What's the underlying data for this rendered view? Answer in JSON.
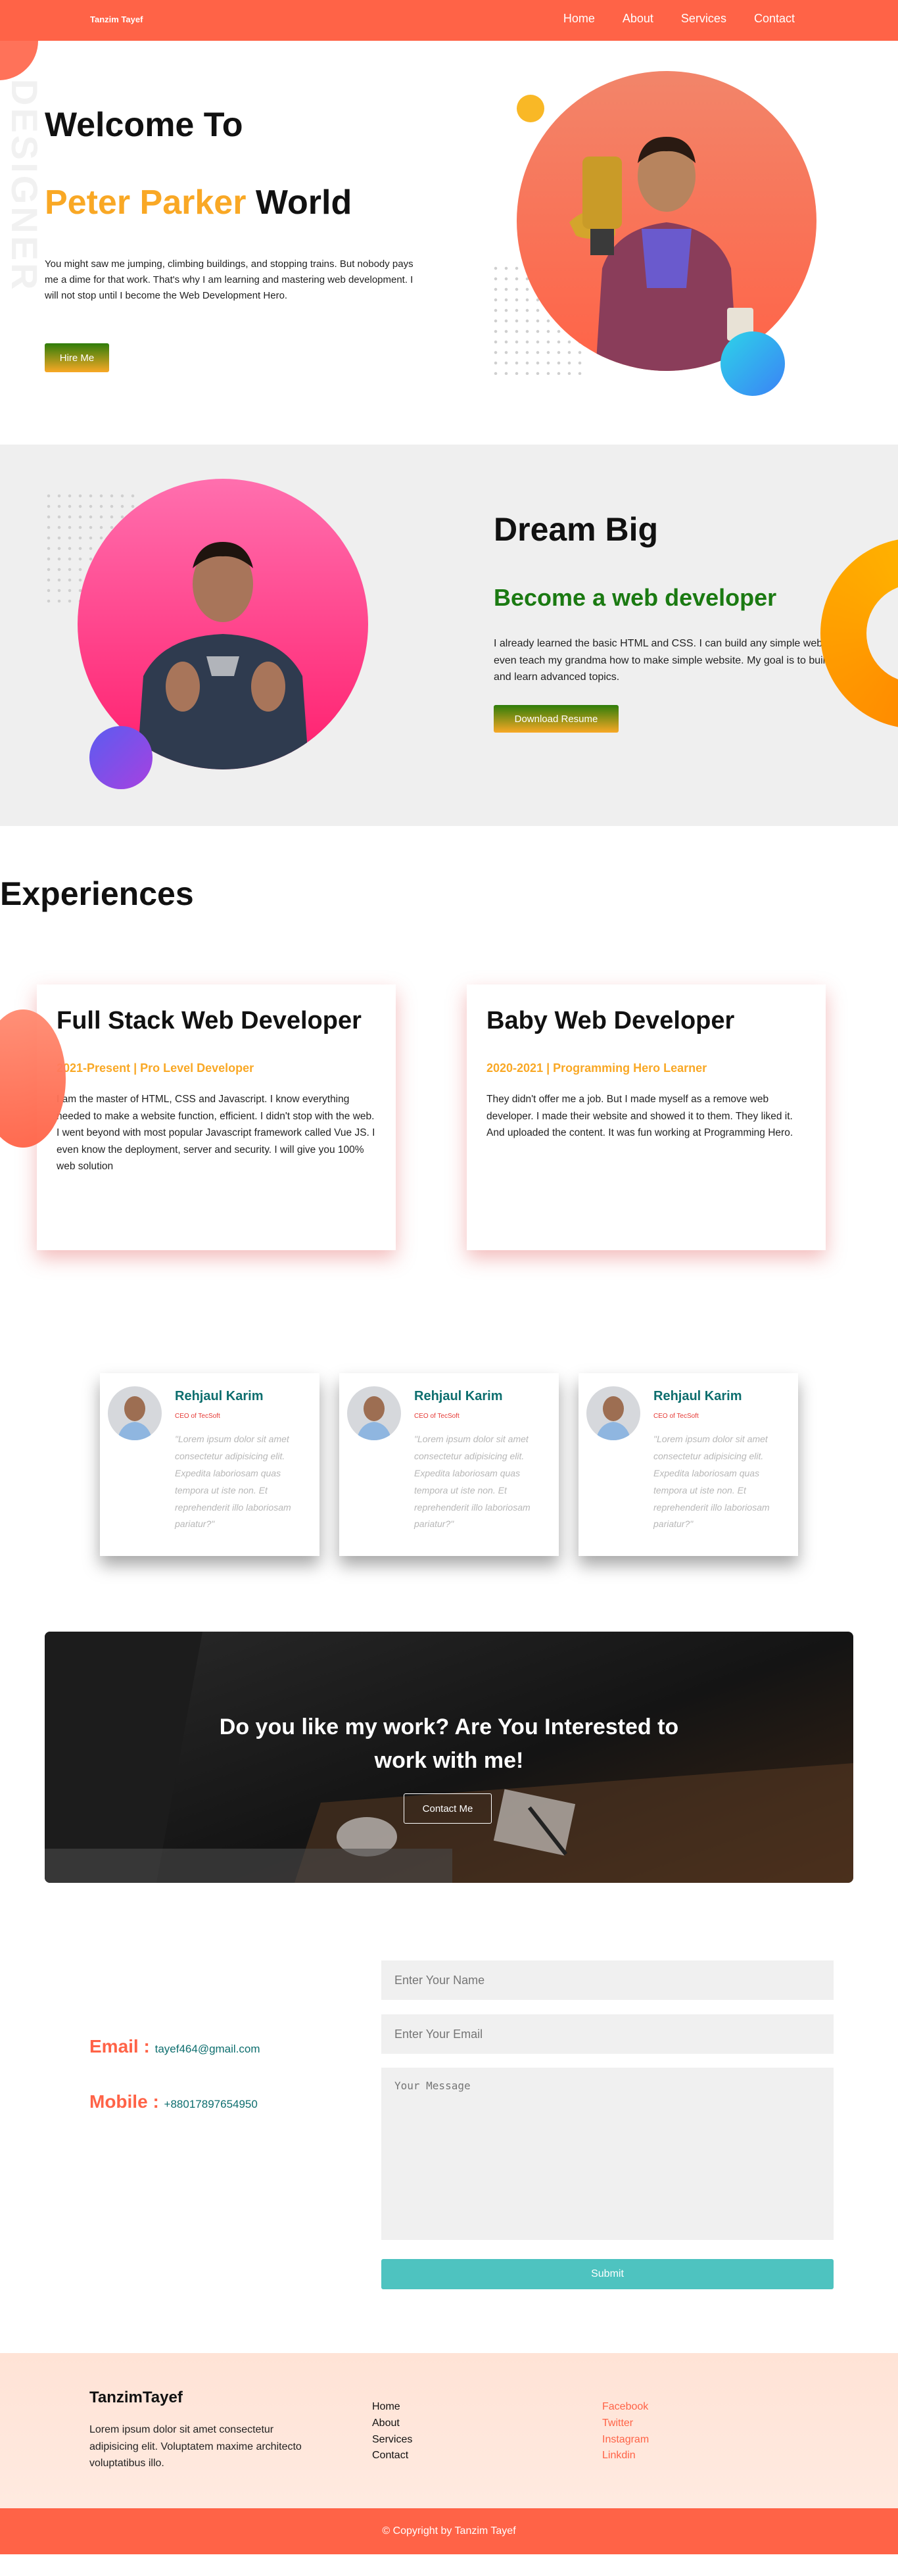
{
  "nav": {
    "brand": "Tanzim Tayef",
    "links": [
      "Home",
      "About",
      "Services",
      "Contact"
    ]
  },
  "hero": {
    "heading_line1": "Welcome To",
    "heading_accent": "Peter Parker",
    "heading_rest": " World",
    "paragraph": "You might saw me jumping, climbing buildings, and stopping trains. But nobody pays me a dime for that work. That's why I am learning and mastering web development. I will not stop until I become the Web Development Hero.",
    "button": "Hire Me"
  },
  "dream": {
    "heading": "Dream Big",
    "subheading": "Become a web developer",
    "paragraph": "I already learned the basic HTML and CSS. I can build any simple website. I can even teach my grandma how to make simple website. My goal is to build 3 websites and learn advanced topics.",
    "button": "Download Resume"
  },
  "experiences": {
    "title": "Experiences",
    "cards": [
      {
        "title": "Full Stack Web Developer",
        "meta": "2021-Present | Pro Level Developer",
        "text": "I am the master of HTML, CSS and Javascript. I know everything needed to make a website function, efficient. I didn't stop with the web. I went beyond with most popular Javascript framework called Vue JS. I even know the deployment, server and security. I will give you 100% web solution"
      },
      {
        "title": "Baby Web Developer",
        "meta": "2020-2021 | Programming Hero Learner",
        "text": "They didn't offer me a job. But I made myself as a remove web developer. I made their website and showed it to them. They liked it. And uploaded the content. It was fun working at Programming Hero."
      }
    ]
  },
  "testimonials": [
    {
      "name": "Rehjaul Karim",
      "role": "CEO of TecSoft",
      "quote": "\"Lorem ipsum dolor sit amet consectetur adipisicing elit. Expedita laboriosam quas tempora ut iste non. Et reprehenderit illo laboriosam pariatur?\""
    },
    {
      "name": "Rehjaul Karim",
      "role": "CEO of TecSoft",
      "quote": "\"Lorem ipsum dolor sit amet consectetur adipisicing elit. Expedita laboriosam quas tempora ut iste non. Et reprehenderit illo laboriosam pariatur?\""
    },
    {
      "name": "Rehjaul Karim",
      "role": "CEO of TecSoft",
      "quote": "\"Lorem ipsum dolor sit amet consectetur adipisicing elit. Expedita laboriosam quas tempora ut iste non. Et reprehenderit illo laboriosam pariatur?\""
    }
  ],
  "cta": {
    "heading": "Do you like my work? Are You Interested to work with me!",
    "button": "Contact Me"
  },
  "contact": {
    "email_label": "Email : ",
    "email_value": "tayef464@gmail.com",
    "mobile_label": "Mobile : ",
    "mobile_value": "+88017897654950",
    "name_placeholder": "Enter Your Name",
    "email_placeholder": "Enter Your Email",
    "message_placeholder": "Your Message",
    "submit": "Submit"
  },
  "footer": {
    "brand": "TanzimTayef",
    "text": "Lorem ipsum dolor sit amet consectetur adipisicing elit. Voluptatem maxime architecto voluptatibus illo.",
    "links": [
      "Home",
      "About",
      "Services",
      "Contact"
    ],
    "social": [
      "Facebook",
      "Twitter",
      "Instagram",
      "Linkdin"
    ],
    "copyright": "© Copyright by Tanzim Tayef"
  },
  "colors": {
    "primary": "#ff6347",
    "accent": "#f9a825",
    "green": "#1b7a12",
    "teal": "#0d6e6e",
    "submit": "#4ec3c0"
  }
}
